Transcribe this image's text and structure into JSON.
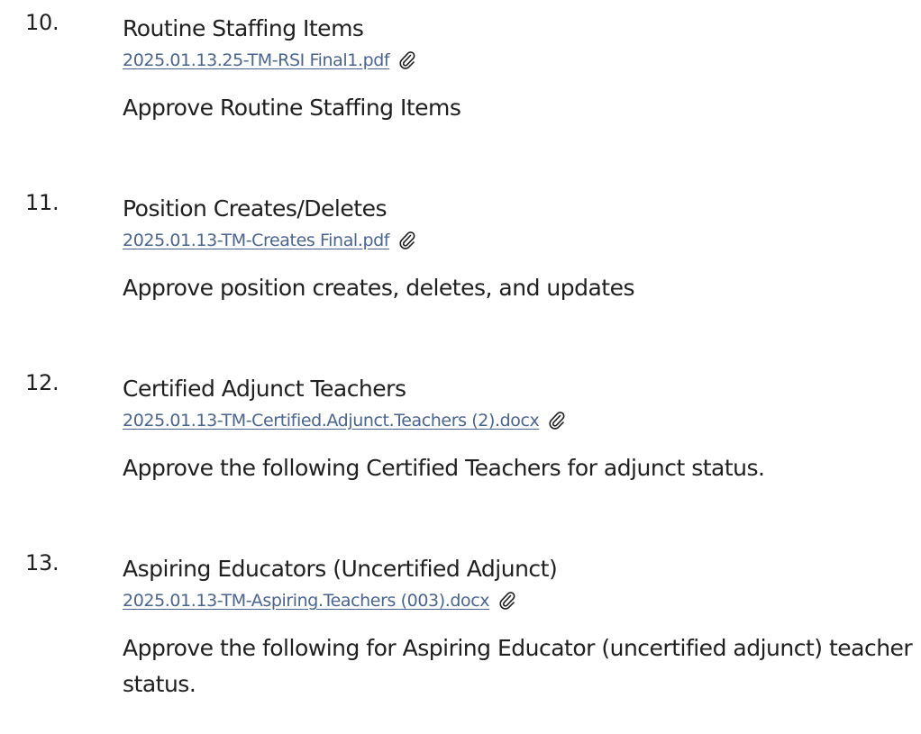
{
  "items": [
    {
      "number": "10.",
      "title": "Routine Staffing Items",
      "attachment": "2025.01.13.25-TM-RSI Final1.pdf",
      "motion": "Approve Routine Staffing Items"
    },
    {
      "number": "11.",
      "title": "Position Creates/Deletes",
      "attachment": "2025.01.13-TM-Creates Final.pdf",
      "motion": "Approve position creates, deletes, and updates"
    },
    {
      "number": "12.",
      "title": "Certified Adjunct Teachers",
      "attachment": "2025.01.13-TM-Certified.Adjunct.Teachers (2).docx",
      "motion": "Approve the following Certified Teachers for adjunct status."
    },
    {
      "number": "13.",
      "title": "Aspiring Educators (Uncertified Adjunct)",
      "attachment": "2025.01.13-TM-Aspiring.Teachers (003).docx",
      "motion": "Approve the following for Aspiring Educator (uncertified adjunct) teacher status."
    }
  ],
  "icons": {
    "attachment": "paperclip-icon"
  },
  "colors": {
    "link": "#4a6490",
    "text": "#1f1f1f",
    "background": "#ffffff"
  }
}
